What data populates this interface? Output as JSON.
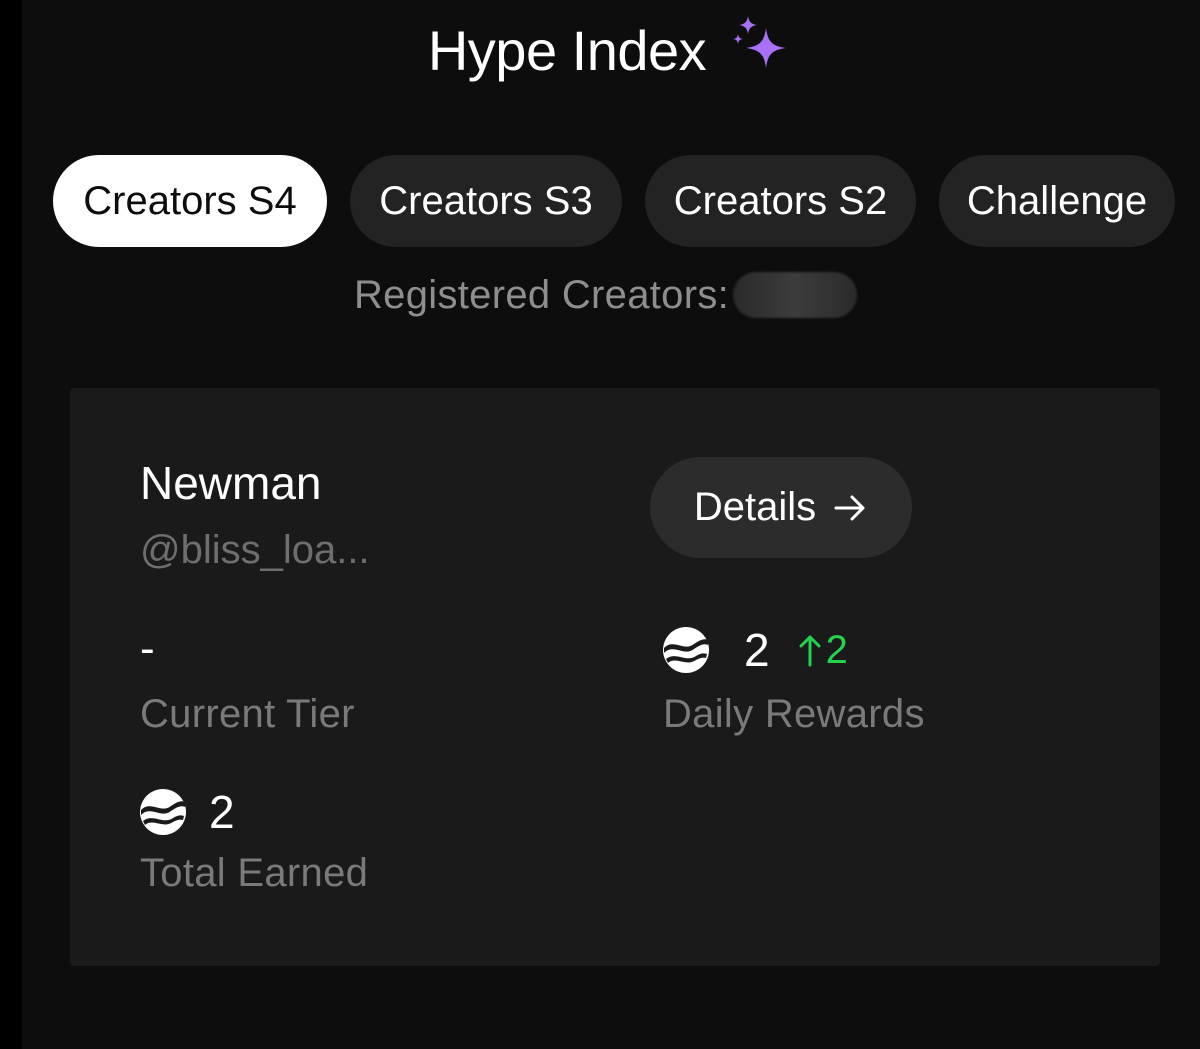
{
  "header": {
    "title": "Hype Index",
    "title_icon": "sparkle-icon"
  },
  "tabs": [
    {
      "label": "Creators S4",
      "active": true
    },
    {
      "label": "Creators S3",
      "active": false
    },
    {
      "label": "Creators S2",
      "active": false
    },
    {
      "label": "Challenge",
      "active": false
    }
  ],
  "registered": {
    "label": "Registered Creators:"
  },
  "card": {
    "name": "Newman",
    "handle": "@bliss_loa...",
    "details_label": "Details",
    "current_tier": {
      "value": "-",
      "label": "Current Tier"
    },
    "daily_rewards": {
      "value": "2",
      "change": "2",
      "label": "Daily Rewards"
    },
    "total_earned": {
      "value": "2",
      "label": "Total Earned"
    }
  },
  "colors": {
    "background": "#0d0d0d",
    "card": "#1a1a1a",
    "accent_green": "#22d34d",
    "sparkle": "#a971f5"
  }
}
